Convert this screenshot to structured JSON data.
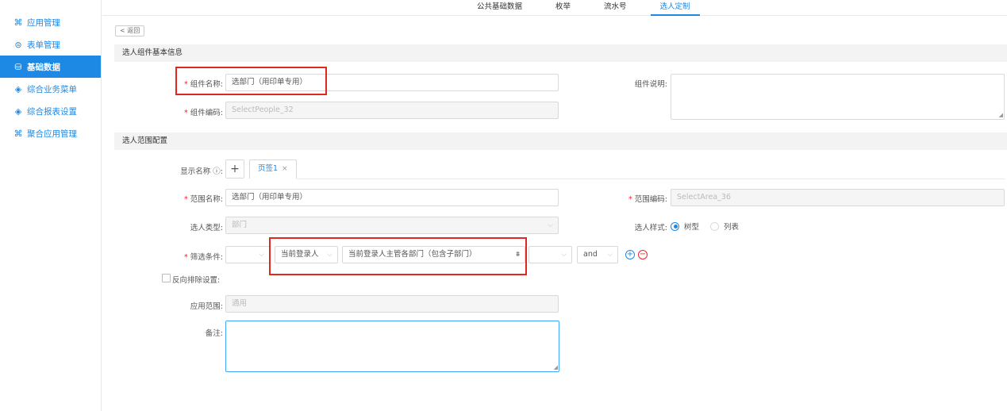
{
  "sidebar": {
    "items": [
      {
        "label": "应用管理",
        "icon": "⌘"
      },
      {
        "label": "表单管理",
        "icon": "⊜"
      },
      {
        "label": "基础数据",
        "icon": "⛁"
      },
      {
        "label": "综合业务菜单",
        "icon": "◈"
      },
      {
        "label": "综合报表设置",
        "icon": "◈"
      },
      {
        "label": "聚合应用管理",
        "icon": "⌘"
      }
    ]
  },
  "topnav": {
    "tabs": [
      "公共基础数据",
      "枚举",
      "流水号",
      "选人定制"
    ]
  },
  "back_label": "< 返回",
  "basic_section": {
    "title": "选人组件基本信息",
    "name_label": "组件名称",
    "name_value": "选部门（用印单专用）",
    "desc_label": "组件说明",
    "code_label": "组件编码",
    "code_value": "SelectPeople_32"
  },
  "range_section": {
    "title": "选人范围配置",
    "display_name_label": "显示名称 ⓘ",
    "page_tab_label": "页签1",
    "range_name_label": "范围名称",
    "range_name_value": "选部门（用印单专用）",
    "range_code_label": "范围编码",
    "range_code_value": "SelectArea_36",
    "type_label": "选人类型",
    "type_value": "部门",
    "style_label": "选人样式",
    "style_options": [
      "树型",
      "列表"
    ],
    "filter_label": "筛选条件",
    "filter_current_user": "当前登录人",
    "filter_dept": "当前登录人主管各部门（包含子部门）",
    "filter_logic": "and",
    "reverse_label": "反向排除设置",
    "scope_label": "应用范围",
    "scope_value": "通用",
    "note_label": "备注"
  },
  "colors": {
    "accent": "#1e88e5",
    "highlight": "#e0281f"
  }
}
